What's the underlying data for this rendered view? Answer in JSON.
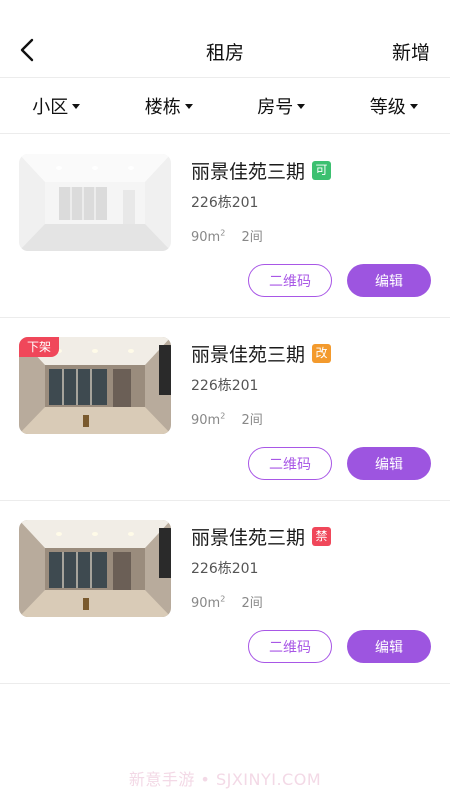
{
  "header": {
    "title": "租房",
    "action_label": "新增",
    "back_icon": "chevron-left-icon"
  },
  "filters": [
    {
      "label": "小区"
    },
    {
      "label": "楼栋"
    },
    {
      "label": "房号"
    },
    {
      "label": "等级"
    }
  ],
  "listings": [
    {
      "name": "丽景佳苑三期",
      "tag": "可",
      "tag_color": "#3cc070",
      "unit": "226栋201",
      "area": "90m",
      "area_sup": "2",
      "rooms": "2间",
      "qr_label": "二维码",
      "edit_label": "编辑",
      "off_label": ""
    },
    {
      "name": "丽景佳苑三期",
      "tag": "改",
      "tag_color": "#f39a2d",
      "unit": "226栋201",
      "area": "90m",
      "area_sup": "2",
      "rooms": "2间",
      "qr_label": "二维码",
      "edit_label": "编辑",
      "off_label": "下架"
    },
    {
      "name": "丽景佳苑三期",
      "tag": "禁",
      "tag_color": "#f0475a",
      "unit": "226栋201",
      "area": "90m",
      "area_sup": "2",
      "rooms": "2间",
      "qr_label": "二维码",
      "edit_label": "编辑",
      "off_label": ""
    }
  ],
  "colors": {
    "accent": "#9d55e0",
    "outline": "#a857e6"
  },
  "watermark": "新意手游 • SJXINYI.COM"
}
